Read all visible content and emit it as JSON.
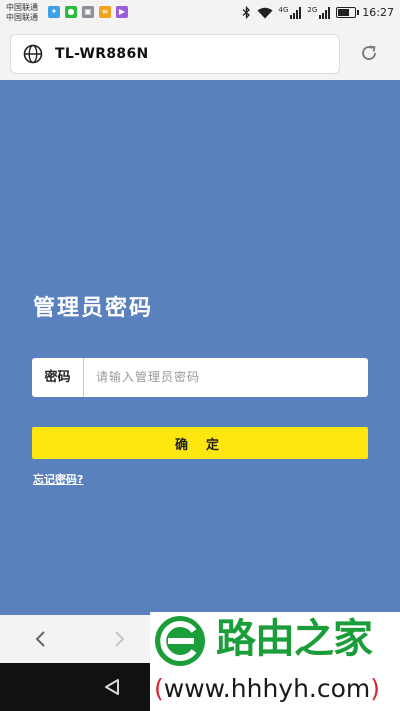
{
  "status_bar": {
    "carrier_1": "中国联通",
    "carrier_2": "中国联通",
    "network_1": "4G",
    "network_2": "2G",
    "battery_level": 0.75,
    "time": "16:27",
    "app_icons": [
      "notification-app-icon",
      "wechat-icon",
      "gallery-icon",
      "notes-icon",
      "video-app-icon"
    ]
  },
  "address_bar": {
    "url": "TL-WR886N",
    "reload_icon": "reload-icon",
    "site_icon": "globe-icon"
  },
  "page": {
    "background_color": "#5a80be",
    "heading": "管理员密码",
    "password_label": "密码",
    "password_placeholder": "请输入管理员密码",
    "submit_label": "确定",
    "submit_color": "#ffe60e",
    "forgot_link": "忘记密码?"
  },
  "browser_toolbar": {
    "back_icon": "chevron-left-icon",
    "forward_icon": "chevron-right-icon"
  },
  "nav_bar": {
    "back_icon": "triangle-back-icon",
    "home_icon": "circle-home-icon"
  },
  "watermark": {
    "brand": "路由之家",
    "url_open": "(",
    "url": "www.hhhyh.com",
    "url_close": ")",
    "brand_color": "#1b9d3a"
  }
}
